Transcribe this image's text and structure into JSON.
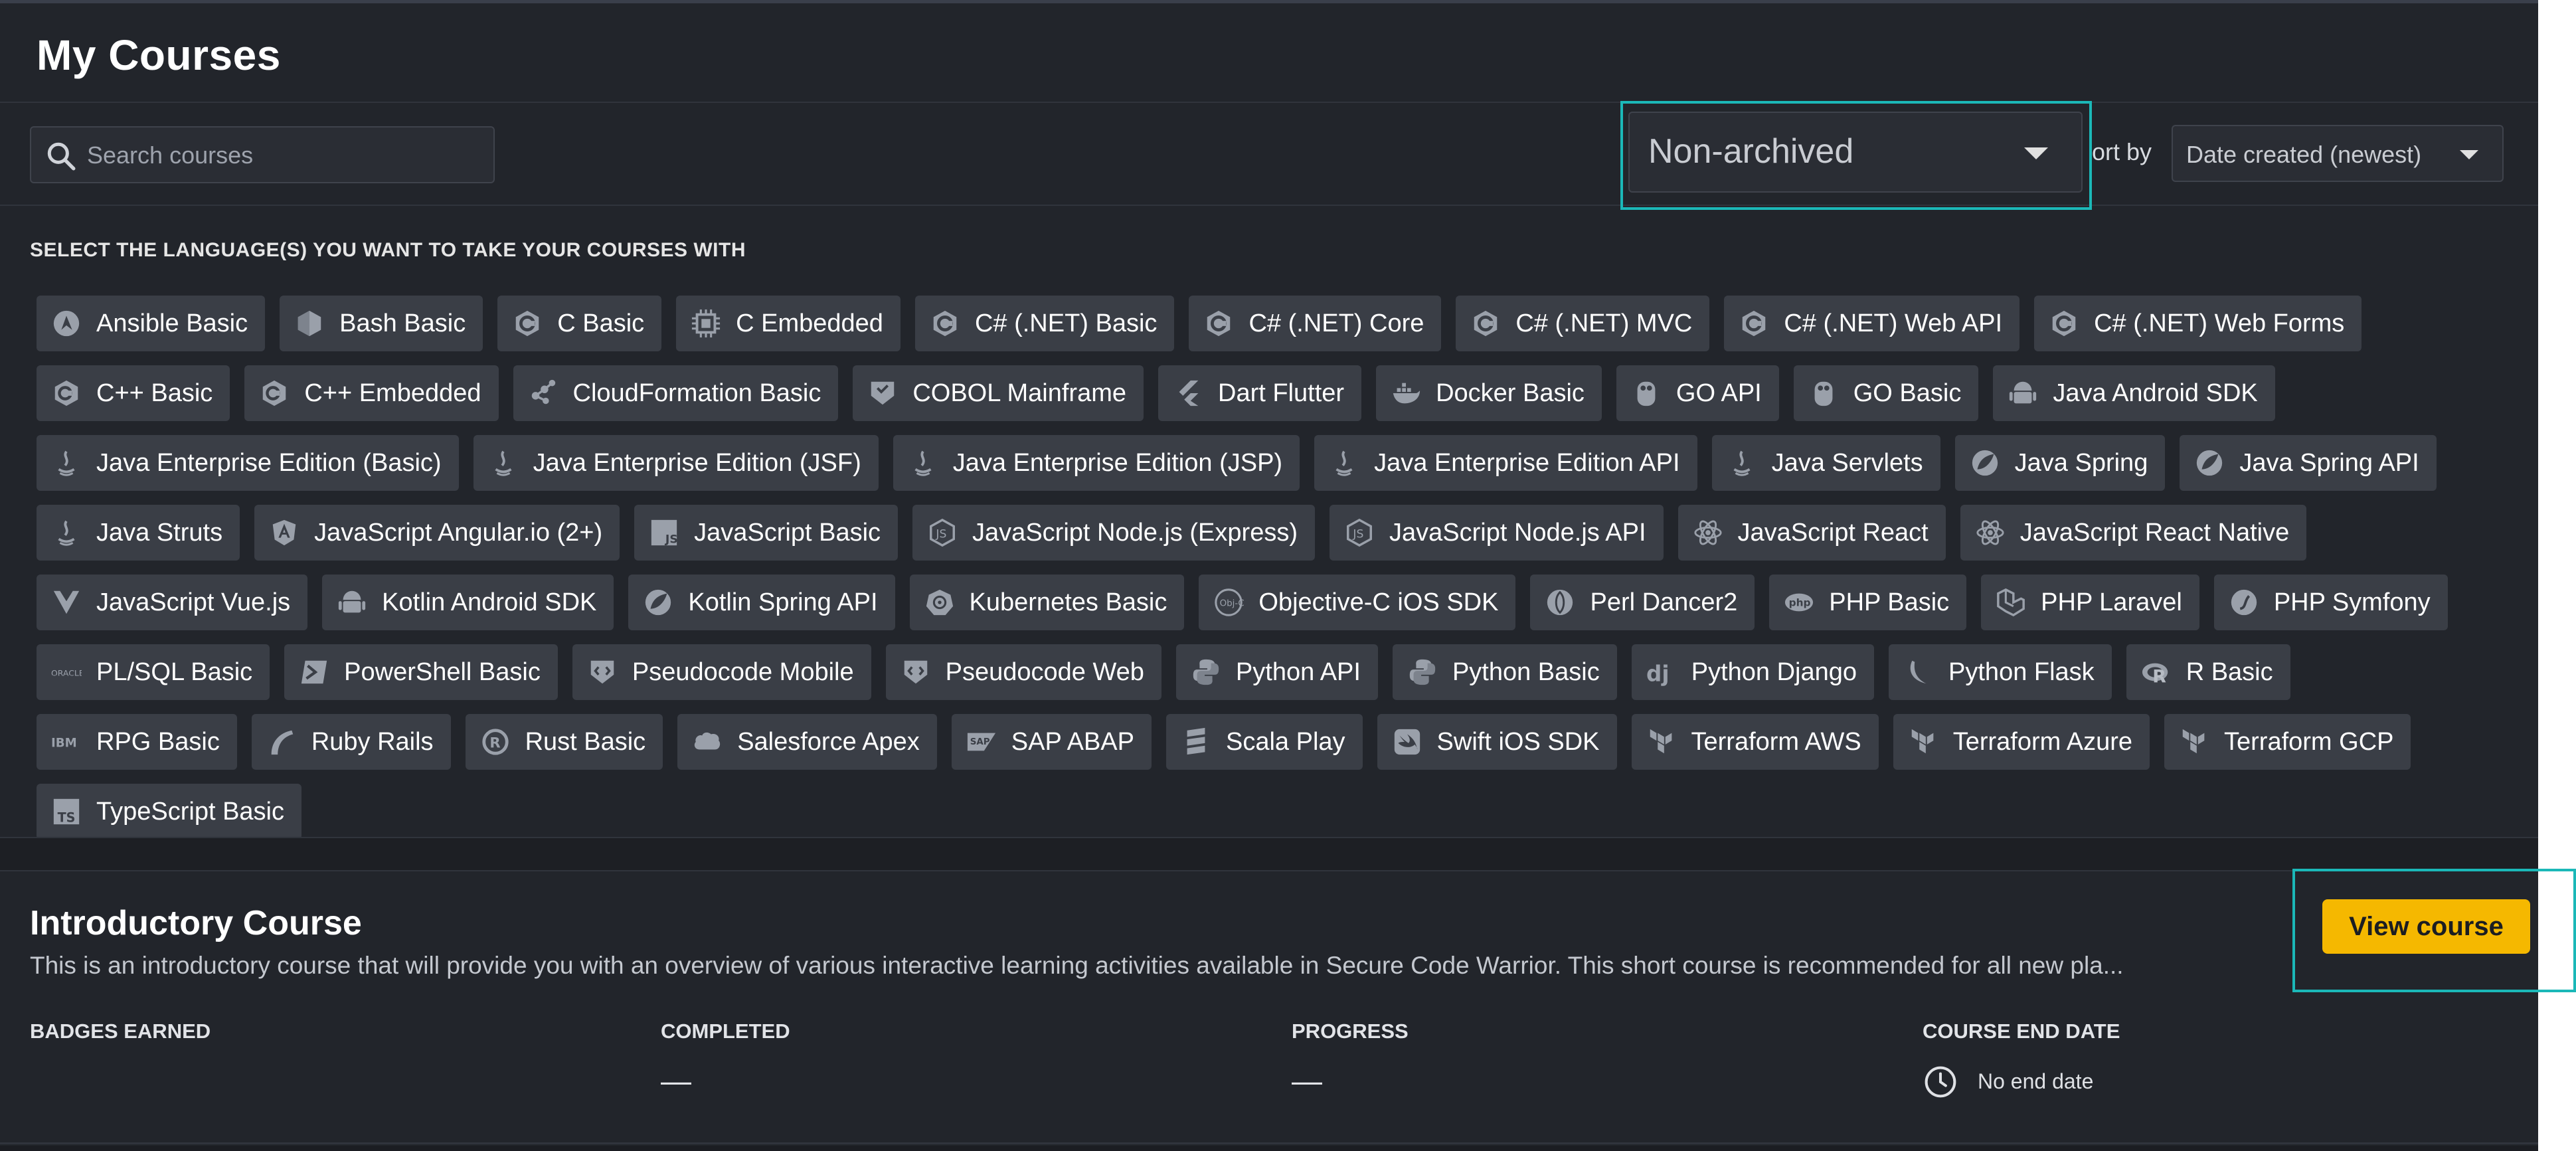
{
  "header": {
    "title": "My Courses"
  },
  "toolbar": {
    "search_placeholder": "Search courses",
    "archive_filter": "Non-archived",
    "sort_label": "ort by",
    "sort_value": "Date created (newest)"
  },
  "languages": {
    "heading": "SELECT THE LANGUAGE(S) YOU WANT TO TAKE YOUR COURSES WITH",
    "items": [
      {
        "label": "Ansible Basic",
        "icon": "ansible-icon"
      },
      {
        "label": "Bash Basic",
        "icon": "bash-icon"
      },
      {
        "label": "C Basic",
        "icon": "c-icon"
      },
      {
        "label": "C Embedded",
        "icon": "chip-icon"
      },
      {
        "label": "C# (.NET) Basic",
        "icon": "csharp-icon"
      },
      {
        "label": "C# (.NET) Core",
        "icon": "csharp-icon"
      },
      {
        "label": "C# (.NET) MVC",
        "icon": "csharp-icon"
      },
      {
        "label": "C# (.NET) Web API",
        "icon": "csharp-icon"
      },
      {
        "label": "C# (.NET) Web Forms",
        "icon": "csharp-icon"
      },
      {
        "label": "C++ Basic",
        "icon": "cpp-icon"
      },
      {
        "label": "C++ Embedded",
        "icon": "cpp-icon"
      },
      {
        "label": "CloudFormation Basic",
        "icon": "cloudformation-icon"
      },
      {
        "label": "COBOL Mainframe",
        "icon": "cobol-icon"
      },
      {
        "label": "Dart Flutter",
        "icon": "flutter-icon"
      },
      {
        "label": "Docker Basic",
        "icon": "docker-icon"
      },
      {
        "label": "GO API",
        "icon": "go-icon"
      },
      {
        "label": "GO Basic",
        "icon": "go-icon"
      },
      {
        "label": "Java Android SDK",
        "icon": "android-icon"
      },
      {
        "label": "Java Enterprise Edition (Basic)",
        "icon": "java-icon"
      },
      {
        "label": "Java Enterprise Edition (JSF)",
        "icon": "java-icon"
      },
      {
        "label": "Java Enterprise Edition (JSP)",
        "icon": "java-icon"
      },
      {
        "label": "Java Enterprise Edition API",
        "icon": "java-icon"
      },
      {
        "label": "Java Servlets",
        "icon": "java-icon"
      },
      {
        "label": "Java Spring",
        "icon": "spring-icon"
      },
      {
        "label": "Java Spring API",
        "icon": "spring-icon"
      },
      {
        "label": "Java Struts",
        "icon": "java-icon"
      },
      {
        "label": "JavaScript Angular.io (2+)",
        "icon": "angular-icon"
      },
      {
        "label": "JavaScript Basic",
        "icon": "js-icon"
      },
      {
        "label": "JavaScript Node.js (Express)",
        "icon": "nodejs-icon"
      },
      {
        "label": "JavaScript Node.js API",
        "icon": "nodejs-icon"
      },
      {
        "label": "JavaScript React",
        "icon": "react-icon"
      },
      {
        "label": "JavaScript React Native",
        "icon": "react-icon"
      },
      {
        "label": "JavaScript Vue.js",
        "icon": "vue-icon"
      },
      {
        "label": "Kotlin Android SDK",
        "icon": "android-icon"
      },
      {
        "label": "Kotlin Spring API",
        "icon": "spring-icon"
      },
      {
        "label": "Kubernetes Basic",
        "icon": "kubernetes-icon"
      },
      {
        "label": "Objective-C iOS SDK",
        "icon": "objc-icon"
      },
      {
        "label": "Perl Dancer2",
        "icon": "perl-icon"
      },
      {
        "label": "PHP Basic",
        "icon": "php-icon"
      },
      {
        "label": "PHP Laravel",
        "icon": "laravel-icon"
      },
      {
        "label": "PHP Symfony",
        "icon": "symfony-icon"
      },
      {
        "label": "PL/SQL Basic",
        "icon": "oracle-icon"
      },
      {
        "label": "PowerShell Basic",
        "icon": "powershell-icon"
      },
      {
        "label": "Pseudocode Mobile",
        "icon": "pseudocode-icon"
      },
      {
        "label": "Pseudocode Web",
        "icon": "pseudocode-icon"
      },
      {
        "label": "Python API",
        "icon": "python-icon"
      },
      {
        "label": "Python Basic",
        "icon": "python-icon"
      },
      {
        "label": "Python Django",
        "icon": "django-icon"
      },
      {
        "label": "Python Flask",
        "icon": "flask-icon"
      },
      {
        "label": "R Basic",
        "icon": "r-icon"
      },
      {
        "label": "RPG Basic",
        "icon": "ibm-icon"
      },
      {
        "label": "Ruby Rails",
        "icon": "rails-icon"
      },
      {
        "label": "Rust Basic",
        "icon": "rust-icon"
      },
      {
        "label": "Salesforce Apex",
        "icon": "salesforce-icon"
      },
      {
        "label": "SAP ABAP",
        "icon": "sap-icon"
      },
      {
        "label": "Scala Play",
        "icon": "scala-icon"
      },
      {
        "label": "Swift iOS SDK",
        "icon": "swift-icon"
      },
      {
        "label": "Terraform AWS",
        "icon": "terraform-icon"
      },
      {
        "label": "Terraform Azure",
        "icon": "terraform-icon"
      },
      {
        "label": "Terraform GCP",
        "icon": "terraform-icon"
      },
      {
        "label": "TypeScript Basic",
        "icon": "typescript-icon"
      }
    ]
  },
  "course": {
    "title": "Introductory Course",
    "description": "This is an introductory course that will provide you with an overview of various interactive learning activities available in Secure Code Warrior. This short course is recommended for all new pla...",
    "view_button": "View course",
    "stats": {
      "badges_label": "BADGES EARNED",
      "completed_label": "COMPLETED",
      "completed_value": "—",
      "progress_label": "PROGRESS",
      "progress_value": "—",
      "end_date_label": "COURSE END DATE",
      "end_date_value": "No end date"
    }
  },
  "colors": {
    "accent_button": "#f5b800",
    "highlight": "#1bb8b8",
    "chip_bg": "#3a3e46"
  }
}
